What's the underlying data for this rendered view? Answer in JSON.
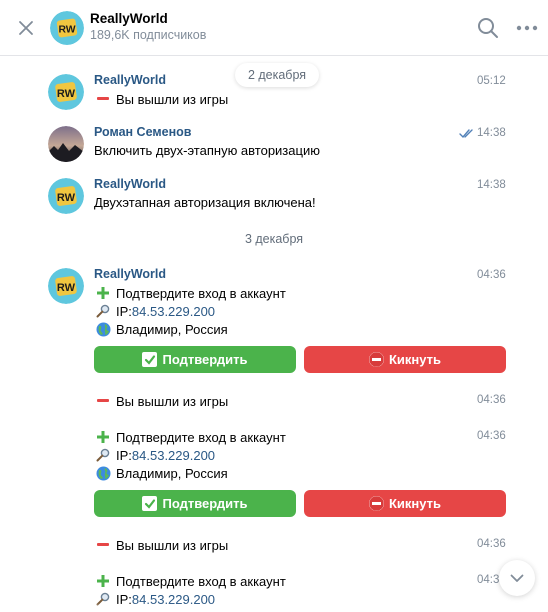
{
  "header": {
    "title": "ReallyWorld",
    "subtitle": "189,6K подписчиков",
    "avatar_text": "RW"
  },
  "dates": {
    "first": "2 декабря",
    "second": "3 декабря"
  },
  "messages": [
    {
      "name": "ReallyWorld",
      "time": "05:12",
      "text": "Вы вышли из игры"
    },
    {
      "name": "Роман Семенов",
      "time": "14:38",
      "text": "Включить двух-этапную авторизацию"
    },
    {
      "name": "ReallyWorld",
      "time": "14:38",
      "text": "Двухэтапная авторизация включена!"
    }
  ],
  "login_block": {
    "name": "ReallyWorld",
    "confirm_text": "Подтвердите вход в аккаунт",
    "ip_label": "IP: ",
    "ip_value": "84.53.229.200",
    "location": "Владимир, Россия",
    "confirm_button": "Подтвердить",
    "kick_button": "Кикнуть",
    "logout_text": "Вы вышли из игры",
    "times": [
      "04:36",
      "04:36",
      "04:36",
      "04:36",
      "04:3"
    ]
  },
  "colors": {
    "green": "#4bb34b",
    "red": "#e64646",
    "link": "#2a5885",
    "muted": "#818c99"
  }
}
